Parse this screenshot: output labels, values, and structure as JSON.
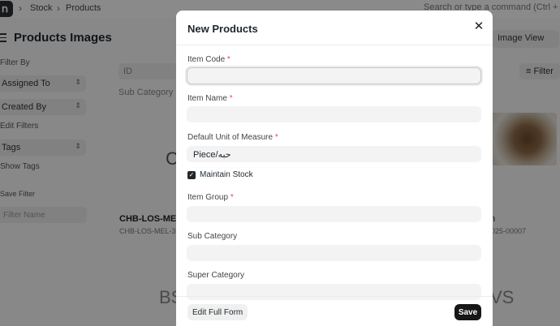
{
  "topbar": {
    "breadcrumb": [
      "Stock",
      "Products"
    ],
    "search_placeholder": "Search or type a command (Ctrl + G)"
  },
  "page": {
    "title": "Products Images",
    "view_button": "Image View",
    "filter_button": "Filter"
  },
  "sidebar": {
    "filter_by_label": "Filter By",
    "assigned_to": "Assigned To",
    "created_by": "Created By",
    "edit_filters": "Edit Filters",
    "tags": "Tags",
    "show_tags": "Show Tags",
    "save_filter_label": "Save Filter",
    "filter_name_placeholder": "Filter Name"
  },
  "list": {
    "id_placeholder": "ID",
    "sub_category_placeholder": "Sub Category",
    "card1_initial": "C",
    "card1_title": "CHB-LOS-MEL-",
    "card1_sub": "CHB-LOS-MEL-3",
    "card2_title": "n",
    "card2_sub": "025-00007",
    "bottom_left_text": "BS",
    "bottom_right_text": "VS"
  },
  "modal": {
    "title": "New Products",
    "fields": {
      "item_code": {
        "label": "Item Code",
        "required": true,
        "value": ""
      },
      "item_name": {
        "label": "Item Name",
        "required": true,
        "value": ""
      },
      "uom": {
        "label": "Default Unit of Measure",
        "required": true,
        "value": "Piece/حبه"
      },
      "maintain_stock": {
        "label": "Maintain Stock",
        "checked": true
      },
      "item_group": {
        "label": "Item Group",
        "required": true,
        "value": ""
      },
      "sub_category": {
        "label": "Sub Category",
        "required": false,
        "value": ""
      },
      "super_category": {
        "label": "Super Category",
        "required": false,
        "value": ""
      }
    },
    "required_marker": "*",
    "edit_full_form": "Edit Full Form",
    "save": "Save",
    "close_glyph": "✕"
  }
}
